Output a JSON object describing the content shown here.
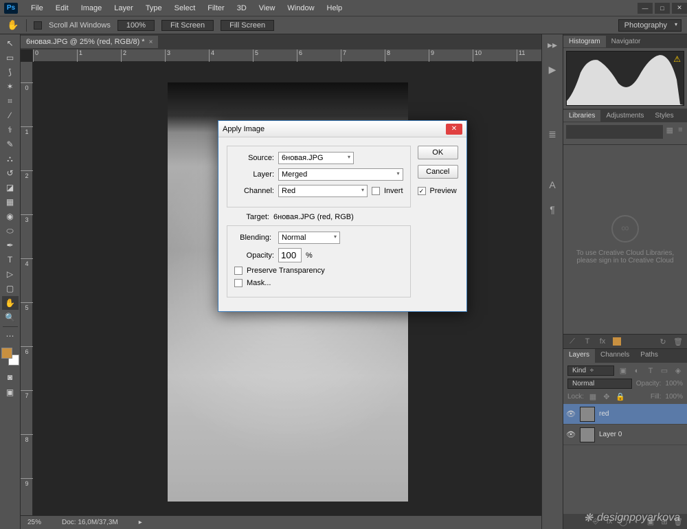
{
  "menu": {
    "items": [
      "File",
      "Edit",
      "Image",
      "Layer",
      "Type",
      "Select",
      "Filter",
      "3D",
      "View",
      "Window",
      "Help"
    ]
  },
  "options": {
    "scroll_all": "Scroll All Windows",
    "zoom_pct": "100%",
    "fit": "Fit Screen",
    "fill": "Fill Screen",
    "workspace": "Photography"
  },
  "doc": {
    "tab_title": "6новая.JPG @ 25% (red, RGB/8) *",
    "status_zoom": "25%",
    "status_doc": "Doc: 16,0M/37,3M"
  },
  "ruler_h": [
    "0",
    "1",
    "2",
    "3",
    "4",
    "5",
    "6",
    "7",
    "8",
    "9",
    "10",
    "11"
  ],
  "ruler_v": [
    "0",
    "1",
    "2",
    "3",
    "4",
    "5",
    "6",
    "7",
    "8",
    "9"
  ],
  "panels": {
    "histogram_tab": "Histogram",
    "navigator_tab": "Navigator",
    "libraries_tab": "Libraries",
    "adjustments_tab": "Adjustments",
    "styles_tab": "Styles",
    "lib_msg1": "To use Creative Cloud Libraries,",
    "lib_msg2": "please sign in to Creative Cloud",
    "layers_tab": "Layers",
    "channels_tab": "Channels",
    "paths_tab": "Paths",
    "kind": "Kind",
    "blend": "Normal",
    "opacity_lbl": "Opacity:",
    "opacity_val": "100%",
    "lock_lbl": "Lock:",
    "fill_lbl": "Fill:",
    "fill_val": "100%",
    "layer_red": "red",
    "layer_0": "Layer 0"
  },
  "dialog": {
    "title": "Apply Image",
    "source_lbl": "Source:",
    "source_val": "6новая.JPG",
    "layer_lbl": "Layer:",
    "layer_val": "Merged",
    "channel_lbl": "Channel:",
    "channel_val": "Red",
    "invert_lbl": "Invert",
    "target_lbl": "Target:",
    "target_val": "6новая.JPG (red, RGB)",
    "blending_lbl": "Blending:",
    "blending_val": "Normal",
    "opacity_lbl": "Opacity:",
    "opacity_val": "100",
    "opacity_pct": "%",
    "preserve_lbl": "Preserve Transparency",
    "mask_lbl": "Mask...",
    "ok": "OK",
    "cancel": "Cancel",
    "preview": "Preview"
  },
  "watermark": "designpoyarkova"
}
